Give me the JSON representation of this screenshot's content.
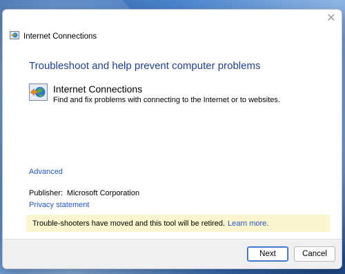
{
  "window": {
    "title": "Internet Connections",
    "close_glyph": "✕"
  },
  "main": {
    "heading": "Troubleshoot and help prevent computer problems",
    "tool_name": "Internet Connections",
    "tool_description": "Find and fix problems with connecting to the Internet or to websites.",
    "tool_icon": "network-troubleshooter-icon"
  },
  "links": {
    "advanced": "Advanced",
    "privacy": "Privacy statement"
  },
  "publisher": {
    "label": "Publisher:",
    "value": "Microsoft Corporation"
  },
  "notice": {
    "text": "Trouble-shooters have moved and this tool will be retired.",
    "link": "Learn more."
  },
  "buttons": {
    "next": "Next",
    "cancel": "Cancel"
  }
}
